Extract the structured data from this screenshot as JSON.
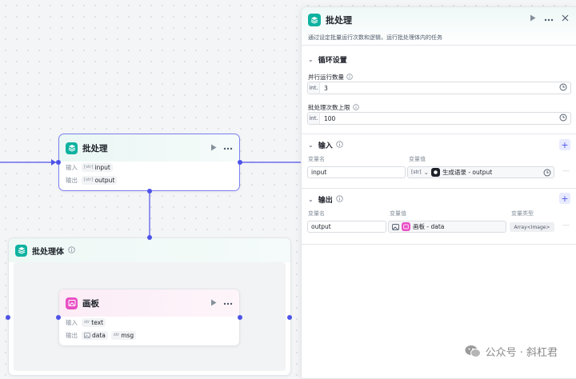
{
  "batch_node": {
    "title": "批处理",
    "input_label": "输入",
    "input_param": "input",
    "output_label": "输出",
    "output_param": "output",
    "array_prefix": "[str]"
  },
  "batch_body": {
    "title": "批处理体"
  },
  "canvas_node": {
    "title": "画板",
    "input_label": "输入",
    "input_param": "text",
    "output_label": "输出",
    "output_params": [
      "data",
      "msg"
    ],
    "str_prefix": "str"
  },
  "panel": {
    "title": "批处理",
    "description": "通过设定批量运行次数和逻辑，运行批处理体内的任务",
    "loop_section": {
      "title": "循环设置",
      "concurrency_label": "并行运行数量",
      "concurrency_value": "3",
      "max_label": "批处理次数上限",
      "max_value": "100",
      "int_prefix": "int."
    },
    "input_section": {
      "title": "输入",
      "col_name": "变量名",
      "col_value": "变量值",
      "row_name": "input",
      "row_ref_prefix": "[str]",
      "row_ref_value": "生成语录 - output"
    },
    "output_section": {
      "title": "输出",
      "col_name": "变量名",
      "col_value": "变量值",
      "col_type": "变量类型",
      "row_name": "output",
      "row_ref_value": "画板 - data",
      "row_type": "Array<Image>"
    }
  },
  "watermark": "公众号 · 斜杠君",
  "colors": {
    "accent": "#4d53e8",
    "batch_icon": "#0fb2a0",
    "canvas_icon": "#e94fc4",
    "selected_border": "#7c7ff0"
  },
  "icons": [
    "batch-icon",
    "canvas-icon",
    "play-icon",
    "more-icon",
    "info-icon",
    "chevron-down-icon",
    "clock-icon",
    "plus-icon",
    "image-icon",
    "wechat-icon"
  ]
}
